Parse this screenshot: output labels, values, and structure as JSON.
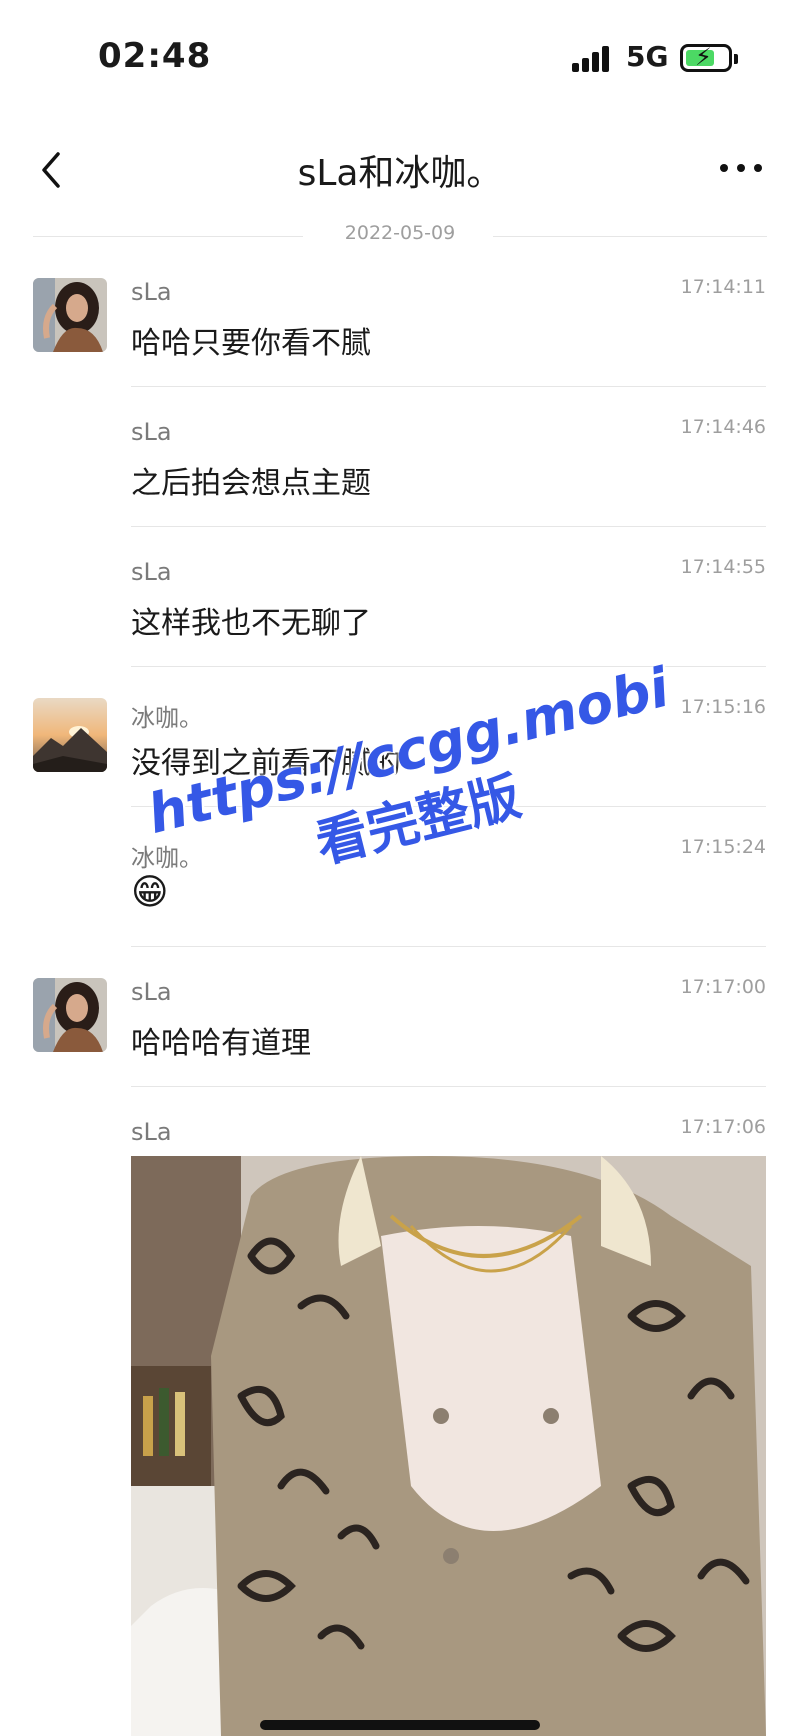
{
  "status_bar": {
    "time": "02:48",
    "network": "5G",
    "battery_charging": true
  },
  "header": {
    "title": "sLa和冰咖。"
  },
  "date_divider": "2022-05-09",
  "messages": [
    {
      "sender": "sLa",
      "time": "17:14:11",
      "text": "哈哈只要你看不腻",
      "avatar": "woman-portrait"
    },
    {
      "sender": "sLa",
      "time": "17:14:46",
      "text": "之后拍会想点主题"
    },
    {
      "sender": "sLa",
      "time": "17:14:55",
      "text": "这样我也不无聊了"
    },
    {
      "sender": "冰咖。",
      "time": "17:15:16",
      "text": "没得到之前看不腻的",
      "avatar": "mountain-sunset"
    },
    {
      "sender": "冰咖。",
      "time": "17:15:24",
      "text": "😁"
    },
    {
      "sender": "sLa",
      "time": "17:17:00",
      "text": "哈哈哈有道理",
      "avatar": "woman-portrait"
    },
    {
      "sender": "sLa",
      "time": "17:17:06",
      "image": "photo-attachment"
    }
  ],
  "watermark": {
    "url": "https://ccgg.mobi",
    "label": "看完整版"
  },
  "colors": {
    "watermark": "#3558e6",
    "divider": "#e6e6e6",
    "meta_text": "#9e9e9e"
  }
}
